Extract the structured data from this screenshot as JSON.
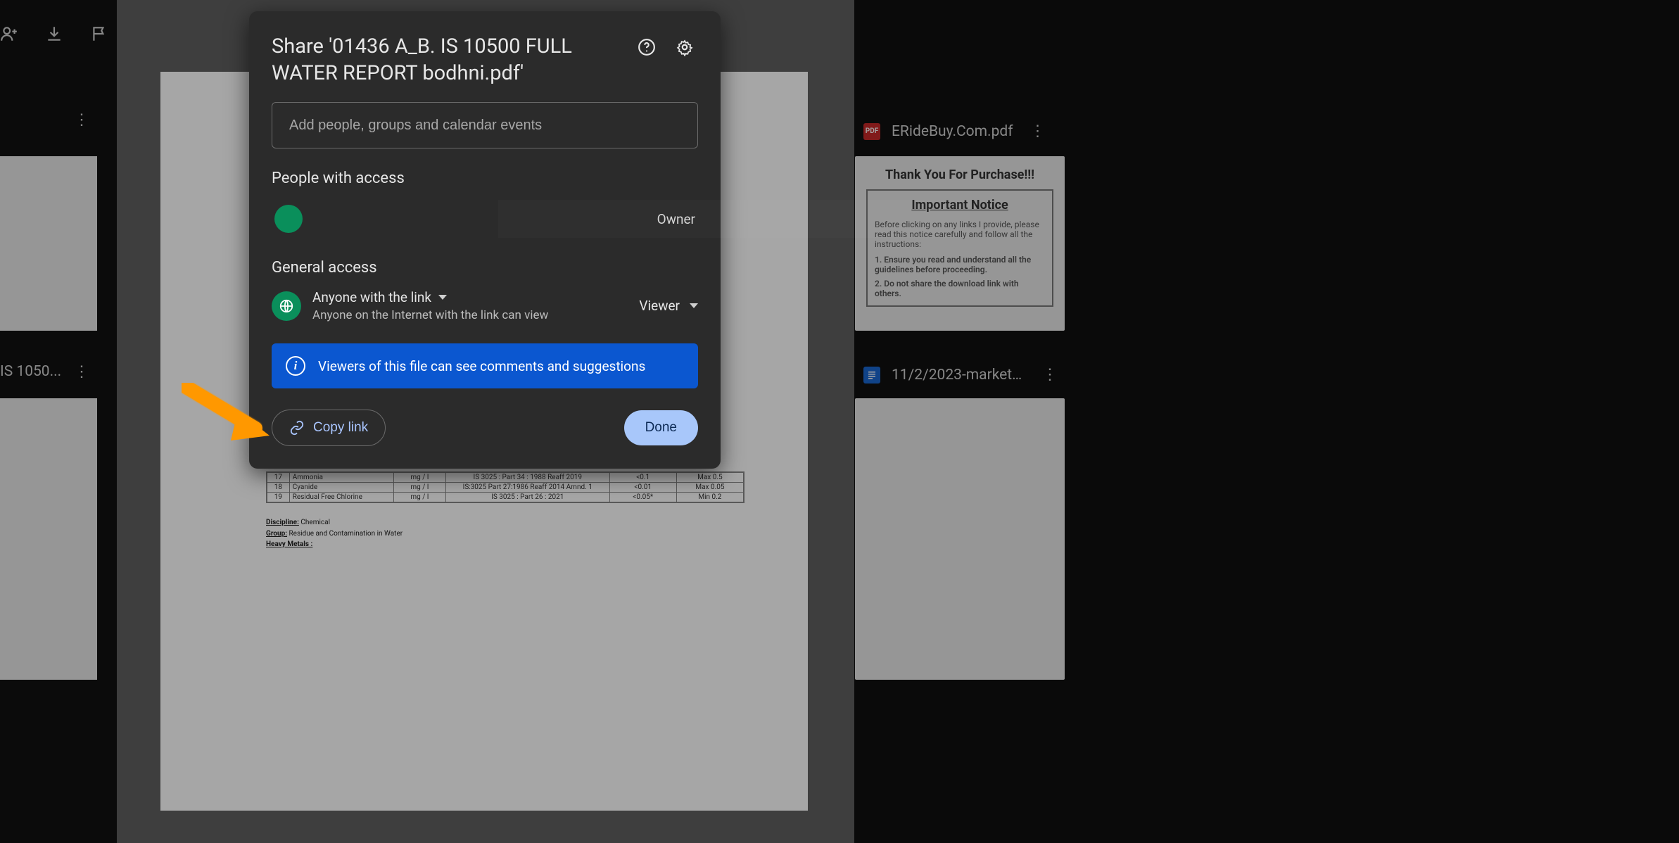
{
  "modal": {
    "title": "Share '01436 A_B. IS 10500 FULL WATER REPORT bodhni.pdf'",
    "input_placeholder": "Add people, groups and calendar events",
    "people_label": "People with access",
    "owner_label": "Owner",
    "general_label": "General access",
    "link_scope": "Anyone with the link",
    "link_scope_sub": "Anyone on the Internet with the link can view",
    "role": "Viewer",
    "info_text": "Viewers of this file can see comments and suggestions",
    "copy_link": "Copy link",
    "done": "Done"
  },
  "right_side": {
    "item1": "ERideBuy.Com.pdf",
    "item2": "11/2/2023-marketm..."
  },
  "left_side": {
    "item2": "IS 1050..."
  },
  "right_preview": {
    "thank": "Thank You For Purchase!!!",
    "important": "Important Notice",
    "p1": "Before clicking on any links I provide, please read this notice carefully and follow all the instructions:",
    "li1": "1. Ensure you read and understand all the guidelines before proceeding.",
    "li2": "2. Do not share the download link with others."
  },
  "doc_rows": [
    {
      "n": "17",
      "name": "Ammonia",
      "unit": "mg / l",
      "ref": "IS 3025 : Part 34 : 1988 Reaff 2019",
      "r": "<0.1",
      "lim": "Max 0.5"
    },
    {
      "n": "18",
      "name": "Cyanide",
      "unit": "mg / l",
      "ref": "IS:3025 Part 27:1986 Reaff 2014 Amnd. 1",
      "r": "<0.01",
      "lim": "Max 0.05"
    },
    {
      "n": "19",
      "name": "Residual Free Chlorine",
      "unit": "mg / l",
      "ref": "IS 3025 : Part 26 : 2021",
      "r": "<0.05*",
      "lim": "Min 0.2"
    }
  ],
  "doc_meta": {
    "disc_l": "Discipline:",
    "disc_v": "Chemical",
    "group_l": "Group:",
    "group_v": "Residue and Contamination in Water",
    "hm": "Heavy Metals :"
  }
}
